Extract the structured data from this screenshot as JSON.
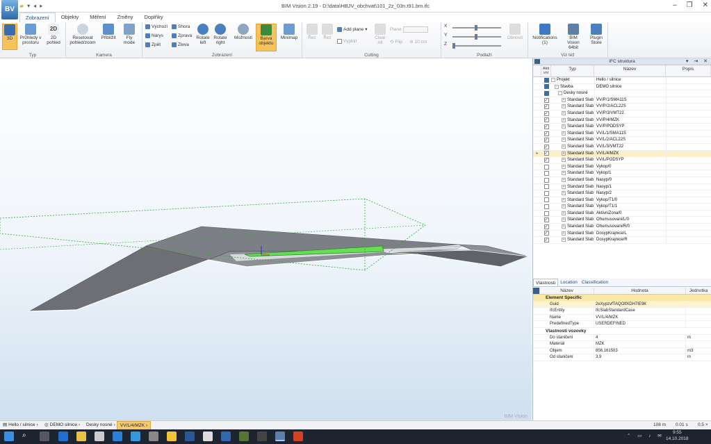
{
  "title": "BIM Vision 2.19 - D:\\data\\HBJV_obchvat\\101_2z_03n.t91.bm.ifc",
  "app_logo": "BV",
  "ribbon": {
    "tabs": [
      "Zobrazení",
      "Objekty",
      "Měření",
      "Změny",
      "Doplňky"
    ],
    "groups": {
      "typ": "Typ",
      "kamera": "Kamera",
      "zobrazeni": "Zobrazení",
      "cutting": "Cutting",
      "podlazi": "Podlaží",
      "viz_tez": "Viz též"
    },
    "buttons": {
      "b3d": "3D",
      "pruhledy": "Průhledy v prostoru",
      "b2d": "2D pohled",
      "reset": "Resetovat pohled/zoom",
      "priblizit": "Přiblížit",
      "fly": "Fly mode",
      "vychozi": "Výchozí",
      "narys": "Nárys",
      "zpet": "Zpět",
      "shora": "Shora",
      "zprava": "Zprava",
      "zleva": "Zleva",
      "rotate_left": "Rotate left",
      "rotate_right": "Rotate right",
      "moznosti": "Možnosti",
      "barva": "Barva objektu",
      "minimap": "Minimap",
      "rez1": "Řez",
      "rez2": "Řez",
      "add_plane": "Add plane",
      "vyplnit": "Vyplnit",
      "clear_all": "Clear All",
      "plane": "Plane",
      "flip": "Flip",
      "cm": "10 cm",
      "x": "X",
      "y": "Y",
      "z": "Z",
      "obnovit": "Obnovit",
      "notifications": "Notifications (1)",
      "bim64": "BIM Vision 64bit",
      "plugin": "Plugin Store"
    }
  },
  "panel": {
    "title": "IFC struktura",
    "columns": {
      "akt": "Akti vní",
      "typ": "Typ",
      "nazev": "Název",
      "popis": "Popis"
    },
    "rows": [
      {
        "check": "solid",
        "indent": 0,
        "typ": "Projekt",
        "nazev": "Hello / silnice",
        "exp": "-"
      },
      {
        "check": "solid",
        "indent": 1,
        "typ": "Stavba",
        "nazev": "DEMO silnice",
        "exp": "-"
      },
      {
        "check": "solid",
        "indent": 2,
        "typ": "Desky nosné",
        "nazev": "",
        "exp": "-"
      },
      {
        "check": "checked",
        "indent": 3,
        "typ": "Standard Slab",
        "nazev": "VV/P/1/SMA11S",
        "exp": "+"
      },
      {
        "check": "checked",
        "indent": 3,
        "typ": "Standard Slab",
        "nazev": "VV/P/2/ACL22S",
        "exp": "+"
      },
      {
        "check": "checked",
        "indent": 3,
        "typ": "Standard Slab",
        "nazev": "VV/P/3/VMT22",
        "exp": "+"
      },
      {
        "check": "checked",
        "indent": 3,
        "typ": "Standard Slab",
        "nazev": "VV/P/4/MZK",
        "exp": "+"
      },
      {
        "check": "checked",
        "indent": 3,
        "typ": "Standard Slab",
        "nazev": "VV/P/PODSYP",
        "exp": "+"
      },
      {
        "check": "checked",
        "indent": 3,
        "typ": "Standard Slab",
        "nazev": "VV/L/1/SMA11S",
        "exp": "+"
      },
      {
        "check": "checked",
        "indent": 3,
        "typ": "Standard Slab",
        "nazev": "VV/L/2/ACL22S",
        "exp": "+"
      },
      {
        "check": "checked",
        "indent": 3,
        "typ": "Standard Slab",
        "nazev": "VV/L/3/VMT22",
        "exp": "+"
      },
      {
        "check": "checked",
        "indent": 3,
        "typ": "Standard Slab",
        "nazev": "VV/L/4/MZK",
        "exp": "+",
        "sel": true
      },
      {
        "check": "checked",
        "indent": 3,
        "typ": "Standard Slab",
        "nazev": "VV/L/PODSYP",
        "exp": "+"
      },
      {
        "check": "empty",
        "indent": 3,
        "typ": "Standard Slab",
        "nazev": "Vykop/0",
        "exp": "+"
      },
      {
        "check": "empty",
        "indent": 3,
        "typ": "Standard Slab",
        "nazev": "Vykop/1",
        "exp": "+"
      },
      {
        "check": "empty",
        "indent": 3,
        "typ": "Standard Slab",
        "nazev": "Nasyp/0",
        "exp": "+"
      },
      {
        "check": "empty",
        "indent": 3,
        "typ": "Standard Slab",
        "nazev": "Nasyp/1",
        "exp": "+"
      },
      {
        "check": "empty",
        "indent": 3,
        "typ": "Standard Slab",
        "nazev": "Nasyp/2",
        "exp": "+"
      },
      {
        "check": "empty",
        "indent": 3,
        "typ": "Standard Slab",
        "nazev": "Vykop/T1/0",
        "exp": "+"
      },
      {
        "check": "empty",
        "indent": 3,
        "typ": "Standard Slab",
        "nazev": "Vykop/T1/1",
        "exp": "+"
      },
      {
        "check": "empty",
        "indent": 3,
        "typ": "Standard Slab",
        "nazev": "AktivniZona/0",
        "exp": "+"
      },
      {
        "check": "checked",
        "indent": 3,
        "typ": "Standard Slab",
        "nazev": "Ohumusovani/L/0",
        "exp": "+"
      },
      {
        "check": "checked",
        "indent": 3,
        "typ": "Standard Slab",
        "nazev": "Ohumusovani/R/0",
        "exp": "+"
      },
      {
        "check": "checked",
        "indent": 3,
        "typ": "Standard Slab",
        "nazev": "DosypKrajnice/L",
        "exp": "+"
      },
      {
        "check": "checked",
        "indent": 3,
        "typ": "Standard Slab",
        "nazev": "DosypKrajnice/R",
        "exp": "+"
      }
    ],
    "prop_tabs": [
      "Vlastnosti",
      "Location",
      "Classification"
    ],
    "prop_columns": {
      "nazev": "Název",
      "hodnota": "Hodnota",
      "jednotka": "Jednotka"
    },
    "sections": [
      {
        "title": "Element Specific",
        "hl": true,
        "rows": [
          {
            "k": "Guid",
            "v": "2eXypzvfTAQOlfXDH7IE9K",
            "u": "",
            "hl": true
          },
          {
            "k": "IfcEntity",
            "v": "IfcSlabStandardCase",
            "u": ""
          },
          {
            "k": "Name",
            "v": "VV/L/4/MZK",
            "u": ""
          },
          {
            "k": "PredefinedType",
            "v": "USERDEFINED",
            "u": ""
          }
        ]
      },
      {
        "title": "Vlastnosti vozovky",
        "hl": false,
        "rows": [
          {
            "k": "Do staničení",
            "v": "4",
            "u": "m"
          },
          {
            "k": "Materiál",
            "v": "MZK",
            "u": ""
          },
          {
            "k": "Objem",
            "v": "856,161503",
            "u": "m3"
          },
          {
            "k": "Od staničení",
            "v": "3,9",
            "u": "m"
          }
        ]
      }
    ]
  },
  "statusbar": {
    "crumbs": [
      "Hello / silnice",
      "DEMO silnice",
      "Desky nosné",
      "VV/L/4/MZK"
    ],
    "watermark": "BIM Vision",
    "distance": "108 m",
    "seconds": "0.01 s",
    "zoom": "0,5 ×"
  },
  "taskbar": {
    "time": "9:55",
    "date": "14.10.2018"
  }
}
